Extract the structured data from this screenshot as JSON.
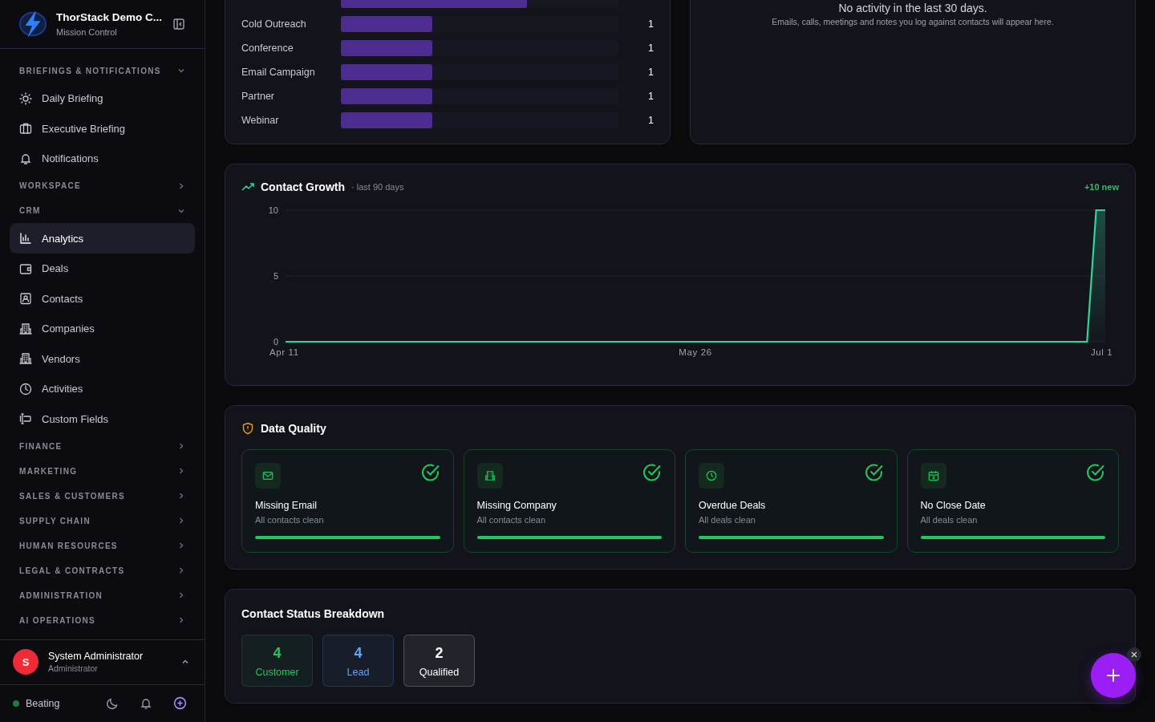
{
  "sidebar": {
    "brand": {
      "title": "ThorStack Demo C...",
      "subtitle": "Mission Control"
    },
    "groups": [
      {
        "label": "BRIEFINGS & NOTIFICATIONS",
        "expanded": true,
        "items": [
          {
            "label": "Daily Briefing",
            "selected": false
          },
          {
            "label": "Executive Briefing",
            "selected": false
          },
          {
            "label": "Notifications",
            "selected": false
          }
        ]
      },
      {
        "label": "WORKSPACE",
        "expanded": false
      },
      {
        "label": "CRM",
        "expanded": true,
        "items": [
          {
            "label": "Analytics",
            "selected": true
          },
          {
            "label": "Deals",
            "selected": false
          },
          {
            "label": "Contacts",
            "selected": false
          },
          {
            "label": "Companies",
            "selected": false
          },
          {
            "label": "Vendors",
            "selected": false
          },
          {
            "label": "Activities",
            "selected": false
          },
          {
            "label": "Custom Fields",
            "selected": false
          }
        ]
      },
      {
        "label": "FINANCE",
        "expanded": false
      },
      {
        "label": "MARKETING",
        "expanded": false
      },
      {
        "label": "SALES & CUSTOMERS",
        "expanded": false
      },
      {
        "label": "SUPPLY CHAIN",
        "expanded": false
      },
      {
        "label": "HUMAN RESOURCES",
        "expanded": false
      },
      {
        "label": "LEGAL & CONTRACTS",
        "expanded": false
      },
      {
        "label": "ADMINISTRATION",
        "expanded": false
      },
      {
        "label": "AI OPERATIONS",
        "expanded": false
      }
    ],
    "user": {
      "initial": "S",
      "name": "System Administrator",
      "role": "Administrator"
    },
    "status": {
      "label": "Beating"
    }
  },
  "lead_sources": {
    "rows": [
      {
        "level": 0.67
      },
      {
        "label": "Cold Outreach",
        "value": "1",
        "level": 0.33
      },
      {
        "label": "Conference",
        "value": "1",
        "level": 0.33
      },
      {
        "label": "Email Campaign",
        "value": "1",
        "level": 0.33
      },
      {
        "label": "Partner",
        "value": "1",
        "level": 0.33
      },
      {
        "label": "Webinar",
        "value": "1",
        "level": 0.33
      }
    ]
  },
  "activity": {
    "empty_title": "No activity in the last 30 days.",
    "empty_text": "Emails, calls, meetings and notes you log against contacts will appear here."
  },
  "contact_growth": {
    "title": "Contact Growth",
    "subtitle": "· last 90 days",
    "badge": "+10 new",
    "chart_data": {
      "type": "area",
      "categories": [
        "Apr 11",
        null,
        null,
        null,
        null,
        null,
        null,
        null,
        null,
        null,
        null,
        null,
        null,
        null,
        null,
        null,
        null,
        null,
        null,
        null,
        null,
        null,
        null,
        null,
        null,
        null,
        null,
        null,
        null,
        null,
        null,
        null,
        null,
        null,
        null,
        null,
        null,
        null,
        null,
        null,
        null,
        null,
        null,
        null,
        null,
        "May 26",
        null,
        null,
        null,
        null,
        null,
        null,
        null,
        null,
        null,
        null,
        null,
        null,
        null,
        null,
        null,
        null,
        null,
        null,
        null,
        null,
        null,
        null,
        null,
        null,
        null,
        null,
        null,
        null,
        null,
        null,
        null,
        null,
        null,
        null,
        null,
        null,
        null,
        null,
        null,
        null,
        null,
        null,
        null,
        null,
        "Jul 1"
      ],
      "series": [
        {
          "color": "#34d399",
          "values": [
            0,
            0,
            0,
            0,
            0,
            0,
            0,
            0,
            0,
            0,
            0,
            0,
            0,
            0,
            0,
            0,
            0,
            0,
            0,
            0,
            0,
            0,
            0,
            0,
            0,
            0,
            0,
            0,
            0,
            0,
            0,
            0,
            0,
            0,
            0,
            0,
            0,
            0,
            0,
            0,
            0,
            0,
            0,
            0,
            0,
            0,
            0,
            0,
            0,
            0,
            0,
            0,
            0,
            0,
            0,
            0,
            0,
            0,
            0,
            0,
            0,
            0,
            0,
            0,
            0,
            0,
            0,
            0,
            0,
            0,
            0,
            0,
            0,
            0,
            0,
            0,
            0,
            0,
            0,
            0,
            0,
            0,
            0,
            0,
            0,
            0,
            0,
            0,
            0,
            10,
            10
          ]
        }
      ],
      "ylim": [
        0,
        10
      ],
      "yticks": [
        0,
        5,
        10
      ]
    }
  },
  "data_quality": {
    "title": "Data Quality",
    "cards": [
      {
        "title": "Missing Email",
        "text": "All contacts clean",
        "level": 1
      },
      {
        "title": "Missing Company",
        "text": "All contacts clean",
        "level": 1
      },
      {
        "title": "Overdue Deals",
        "text": "All deals clean",
        "level": 1
      },
      {
        "title": "No Close Date",
        "text": "All deals clean",
        "level": 1
      }
    ]
  },
  "status_breakdown": {
    "title": "Contact Status Breakdown",
    "items": [
      {
        "count": "4",
        "label": "Customer",
        "color": "#22c55e"
      },
      {
        "count": "4",
        "label": "Lead",
        "color": "#60a5fa"
      },
      {
        "count": "2",
        "label": "Qualified",
        "color": "#ffffff"
      }
    ]
  }
}
